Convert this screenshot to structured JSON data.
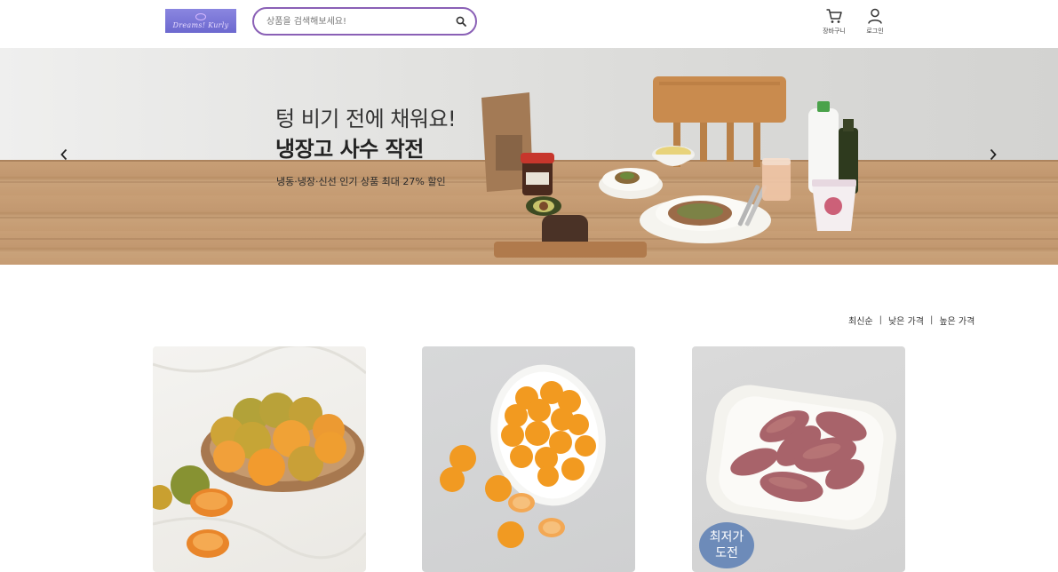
{
  "header": {
    "logo_text": "Dreams! Kurly",
    "search_placeholder": "상품을 검색해보세요!",
    "cart_label": "장바구니",
    "login_label": "로그인"
  },
  "banner": {
    "headline_1": "텅 비기 전에 채워요!",
    "headline_2": "냉장고 사수 작전",
    "subline": "냉동·냉장·신선 인기 상품 최대 27% 할인",
    "prev_icon": "chevron-left-icon",
    "next_icon": "chevron-right-icon"
  },
  "sort": {
    "items": [
      "최신순",
      "낮은 가격",
      "높은 가격"
    ],
    "separator": "|"
  },
  "products": [
    {
      "image": "tangerines-in-basket"
    },
    {
      "image": "tangerines-on-plate"
    },
    {
      "image": "sweet-potatoes-on-plate",
      "badge": "최저가 도전"
    }
  ],
  "colors": {
    "search_border": "#8a60b6",
    "logo_bg": "#6c68cf",
    "badge_bg": "#6d8bb9"
  }
}
